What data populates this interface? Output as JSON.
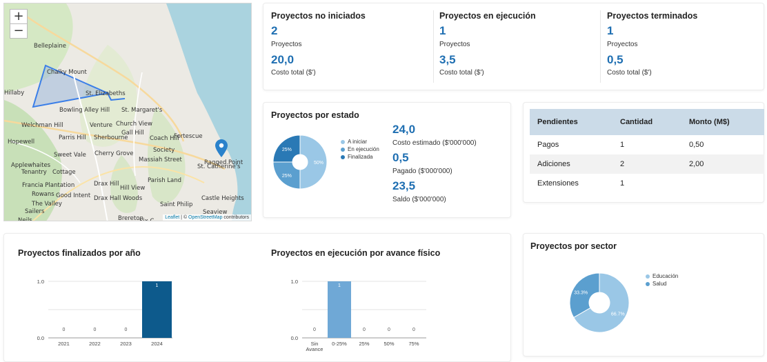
{
  "map": {
    "zoom_in": "+",
    "zoom_out": "−",
    "labels": [
      "Belleplaine",
      "Chalky Mount",
      "St. Elizabeths",
      "Hillaby",
      "Bowling Alley Hill",
      "St. Margaret's",
      "Welchman Hill",
      "Venture",
      "Church View",
      "Hopewell",
      "Parris Hill",
      "Sherbourne",
      "Gall Hill",
      "Coach Hill",
      "Fortescue",
      "Sweet Vale",
      "Cherry Grove",
      "Society",
      "Applewhaites",
      "Tenantry",
      "Cottage",
      "Massiah Street",
      "St. Catherine's",
      "Ragged Point",
      "Francia Plantation",
      "Drax Hill",
      "Hill View",
      "Parish Land",
      "Rowans",
      "Good Intent",
      "Drax Hall Woods",
      "Castle Heights",
      "Saint Philip",
      "The Valley",
      "Seaview",
      "Sailers",
      "Brereton",
      "Six C",
      "Neils"
    ],
    "attribution_leaflet": "Leaflet",
    "attribution_sep": " | © ",
    "attribution_osm": "OpenStreetMap",
    "attribution_tail": " contributors"
  },
  "kpis": [
    {
      "title": "Proyectos no iniciados",
      "count": "2",
      "count_label": "Proyectos",
      "cost": "20,0",
      "cost_label": "Costo total ($')"
    },
    {
      "title": "Proyectos en ejecución",
      "count": "1",
      "count_label": "Proyectos",
      "cost": "3,5",
      "cost_label": "Costo total ($')"
    },
    {
      "title": "Proyectos terminados",
      "count": "1",
      "count_label": "Proyectos",
      "cost": "0,5",
      "cost_label": "Costo total ($')"
    }
  ],
  "estado": {
    "title": "Proyectos por estado",
    "legend": [
      "A iniciar",
      "En ejecución",
      "Finalizada"
    ],
    "slice_labels": [
      "50%",
      "25%",
      "25%"
    ],
    "stats": [
      {
        "value": "24,0",
        "label": "Costo estimado ($'000'000)"
      },
      {
        "value": "0,5",
        "label": "Pagado ($'000'000)"
      },
      {
        "value": "23,5",
        "label": "Saldo ($'000'000)"
      }
    ]
  },
  "pendientes": {
    "headers": [
      "Pendientes",
      "Cantidad",
      "Monto (M$)"
    ],
    "rows": [
      [
        "Pagos",
        "1",
        "0,50"
      ],
      [
        "Adiciones",
        "2",
        "2,00"
      ],
      [
        "Extensiones",
        "1",
        ""
      ]
    ]
  },
  "finalizados": {
    "title": "Proyectos finalizados por año"
  },
  "avance": {
    "title": "Proyectos en ejecución por avance físico"
  },
  "sector": {
    "title": "Proyectos por sector",
    "legend": [
      "Educación",
      "Salud"
    ],
    "slice_labels": [
      "33.3%",
      "66.7%"
    ]
  },
  "colors": {
    "blue_dark": "#0d5a8c",
    "blue_light": "#6fa8d6",
    "blue_pale": "#9ac7e6",
    "accent": "#1f6fb2"
  },
  "chart_data": [
    {
      "type": "pie",
      "title": "Proyectos por estado",
      "categories": [
        "A iniciar",
        "En ejecución",
        "Finalizada"
      ],
      "values": [
        50,
        25,
        25
      ],
      "colors": [
        "#9ac7e6",
        "#5b9fcf",
        "#2a79b5"
      ]
    },
    {
      "type": "bar",
      "title": "Proyectos finalizados por año",
      "categories": [
        "2021",
        "2022",
        "2023",
        "2024"
      ],
      "values": [
        0,
        0,
        0,
        1
      ],
      "ylim": [
        0,
        1
      ],
      "yticks": [
        "0.0",
        "0.5",
        "1.0"
      ],
      "color": "#0d5a8c"
    },
    {
      "type": "bar",
      "title": "Proyectos en ejecución por avance físico",
      "categories": [
        "Sin Avance",
        "0-25%",
        "25%",
        "50%",
        "75%"
      ],
      "values": [
        0,
        1,
        0,
        0,
        0
      ],
      "ylim": [
        0,
        1
      ],
      "yticks": [
        "0.0",
        "0.5",
        "1.0"
      ],
      "color": "#6fa8d6"
    },
    {
      "type": "pie",
      "title": "Proyectos por sector",
      "categories": [
        "Educación",
        "Salud"
      ],
      "values": [
        66.7,
        33.3
      ],
      "colors": [
        "#9ac7e6",
        "#5b9fcf"
      ]
    }
  ]
}
